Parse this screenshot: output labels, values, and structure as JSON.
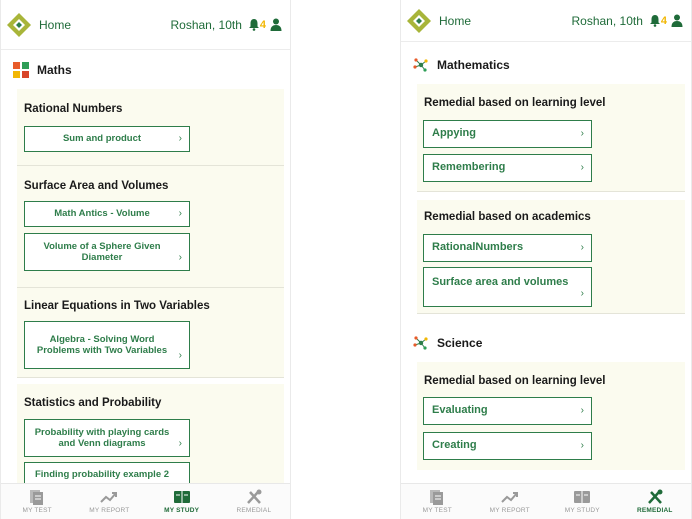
{
  "colors": {
    "brand_green": "#2e7d4a",
    "accent_yellow": "#f2b705",
    "section_bg": "#fbfbef"
  },
  "header": {
    "home": "Home",
    "user": "Roshan, 10th",
    "notifications": "4"
  },
  "study_screen": {
    "subject": "Maths",
    "sections": [
      {
        "title": "Rational Numbers",
        "items": [
          "Sum and product"
        ]
      },
      {
        "title": "Surface Area and Volumes",
        "items": [
          "Math Antics - Volume",
          "Volume of a Sphere Given Diameter"
        ]
      },
      {
        "title": "Linear Equations in Two Variables",
        "items": [
          "Algebra - Solving Word Problems with Two Variables"
        ]
      },
      {
        "title": "Statistics and Probability",
        "items": [
          "Probability with playing cards and Venn diagrams",
          "Finding probability example 2"
        ]
      }
    ]
  },
  "remedial_screen": {
    "subjects": [
      {
        "name": "Mathematics",
        "groups": [
          {
            "title": "Remedial based on learning level",
            "items": [
              "Appying",
              "Remembering"
            ]
          },
          {
            "title": "Remedial based on academics",
            "items": [
              "RationalNumbers",
              "Surface area and volumes"
            ]
          }
        ]
      },
      {
        "name": "Science",
        "groups": [
          {
            "title": "Remedial based on learning level",
            "items": [
              "Evaluating",
              "Creating"
            ]
          }
        ]
      }
    ]
  },
  "nav": {
    "test": "MY TEST",
    "report": "MY REPORT",
    "study": "MY STUDY",
    "remedial": "REMEDIAL"
  },
  "chevron": "›",
  "active_tab_left": "MY STUDY",
  "active_tab_right": "REMEDIAL"
}
